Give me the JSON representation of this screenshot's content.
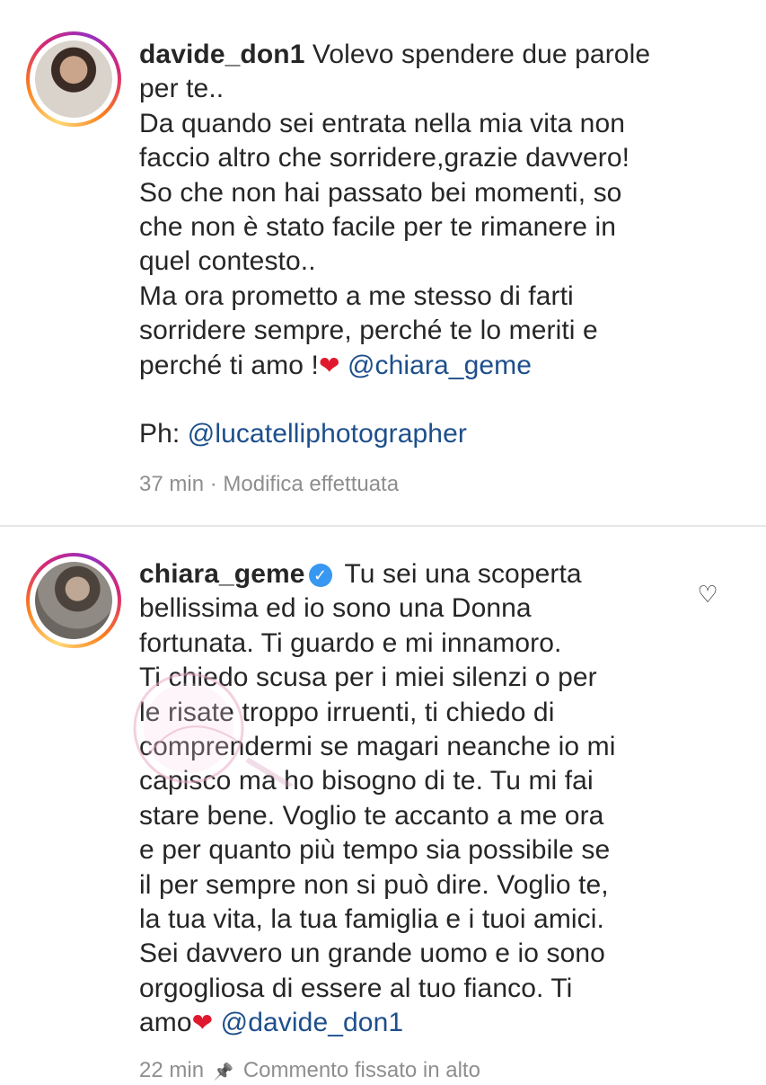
{
  "posts": [
    {
      "username": "davide_don1",
      "lines": [
        "Volevo spendere due parole",
        "per te..",
        "Da quando sei entrata nella mia vita non",
        "faccio altro che sorridere,grazie davvero!",
        "So che non hai passato bei momenti, so",
        "che non è stato facile per te rimanere in",
        "quel contesto..",
        "Ma ora prometto a me stesso di farti",
        "sorridere sempre, perché te lo meriti e",
        "perché ti amo !"
      ],
      "mention": "@chiara_geme",
      "photo_label": "Ph:",
      "photo_mention": "@lucatelliphotographer",
      "time": "37 min",
      "separator": "·",
      "status": "Modifica effettuata"
    },
    {
      "username": "chiara_geme",
      "verified_icon": "verified-badge-icon",
      "lines": [
        "Tu sei una scoperta",
        "bellissima ed io sono una Donna",
        "fortunata. Ti guardo e mi innamoro.",
        "Ti chiedo scusa per i miei silenzi o per",
        "le risate troppo irruenti, ti chiedo di",
        "comprendermi se magari neanche io mi",
        "capisco ma ho bisogno di te. Tu mi fai",
        "stare bene. Voglio te accanto a me ora",
        "e per quanto più tempo sia possibile se",
        "il per sempre non si può dire. Voglio te,",
        "la tua vita, la tua famiglia e i tuoi amici.",
        "Sei davvero un grande uomo e io sono",
        "orgogliosa di essere al tuo fianco. Ti",
        "amo"
      ],
      "mention": "@davide_don1",
      "time": "22 min",
      "status": "Commento fissato in alto"
    }
  ],
  "icons": {
    "heart": "❤",
    "like": "♡",
    "pin": "📌",
    "verified": "✓"
  },
  "colors": {
    "mention": "#1d4f8c",
    "heart": "#e0182d",
    "meta": "#8e8e8e",
    "verified": "#3897f0"
  }
}
